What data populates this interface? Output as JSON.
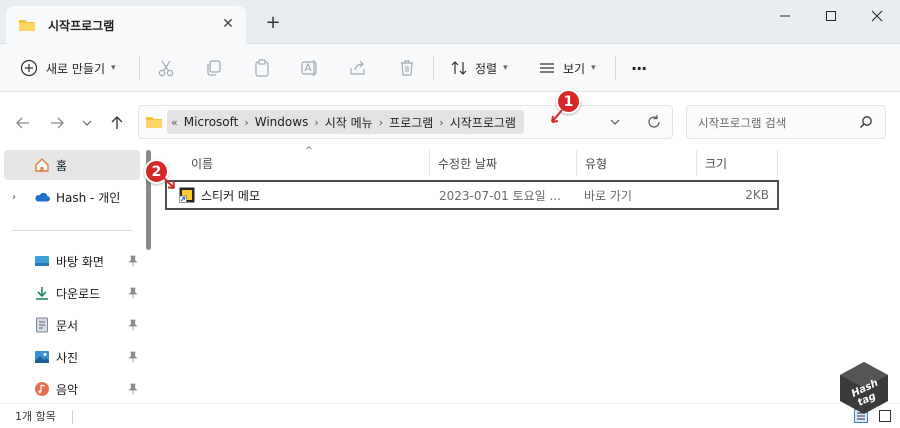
{
  "window": {
    "tab_title": "시작프로그램",
    "tab_close": "✕",
    "new_tab": "+",
    "minimize": "—",
    "maximize": "☐",
    "close": "✕"
  },
  "toolbar": {
    "new_label": "새로 만들기",
    "sort_label": "정렬",
    "view_label": "보기",
    "more_label": "···"
  },
  "address": {
    "overflow": "«",
    "crumbs": [
      "Microsoft",
      "Windows",
      "시작 메뉴",
      "프로그램",
      "시작프로그램"
    ],
    "search_placeholder": "시작프로그램 검색"
  },
  "annotations": {
    "one": "1",
    "two": "2"
  },
  "sidebar": {
    "items": [
      {
        "label": "홈",
        "icon": "home-icon",
        "selected": true
      },
      {
        "label": "Hash - 개인",
        "icon": "onedrive-cloud-icon",
        "selected": false
      },
      {
        "label": "바탕 화면",
        "icon": "desktop-icon",
        "pinned": true
      },
      {
        "label": "다운로드",
        "icon": "download-icon",
        "pinned": true
      },
      {
        "label": "문서",
        "icon": "document-icon",
        "pinned": true
      },
      {
        "label": "사진",
        "icon": "picture-icon",
        "pinned": true
      },
      {
        "label": "음악",
        "icon": "music-icon",
        "pinned": true
      }
    ]
  },
  "columns": {
    "name": "이름",
    "modified": "수정한 날짜",
    "type": "유형",
    "size": "크기"
  },
  "files": [
    {
      "name": "스티커 메모",
      "modified": "2023-07-01 토요일 ...",
      "type": "바로 가기",
      "size": "2KB"
    }
  ],
  "status": {
    "item_count": "1개 항목"
  },
  "watermark": {
    "text_top": "Hash",
    "text_bottom": "tag"
  },
  "colors": {
    "accent": "#0067c0",
    "badge_red": "#d62828",
    "folder_yellow": "#f5c342"
  }
}
